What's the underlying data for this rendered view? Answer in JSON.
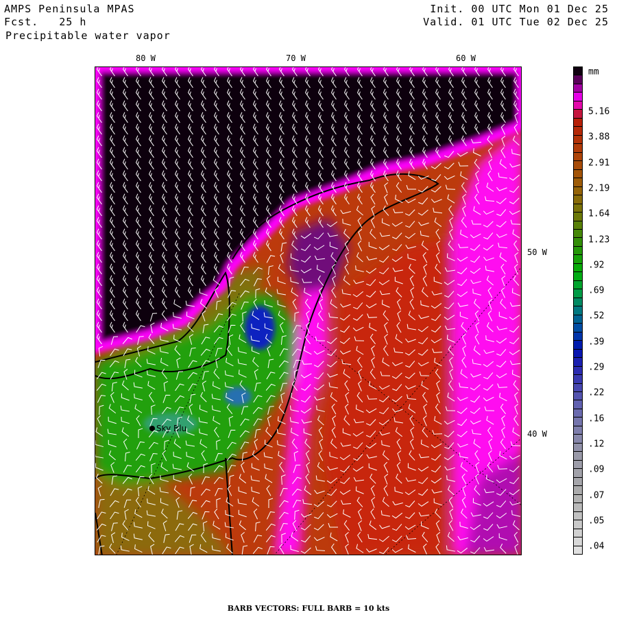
{
  "header": {
    "model": "AMPS Peninsula MPAS",
    "forecast": "Fcst.   25 h",
    "field": "Precipitable water vapor",
    "init": "Init. 00 UTC Mon 01 Dec 25",
    "valid": "Valid. 01 UTC Tue 02 Dec 25"
  },
  "map": {
    "lon_labels": [
      "80 W",
      "70 W",
      "60 W",
      "50 W",
      "40 W"
    ],
    "station": "Sky Blu"
  },
  "colorbar": {
    "units": "mm",
    "labels": [
      "5.16",
      "3.88",
      "2.91",
      "2.19",
      "1.64",
      "1.23",
      ".92",
      ".69",
      ".52",
      ".39",
      ".29",
      ".22",
      ".16",
      ".12",
      ".09",
      ".07",
      ".05",
      ".04"
    ],
    "stops": [
      [
        "0",
        "#100010"
      ],
      [
        "0.02",
        "#640064"
      ],
      [
        "0.04",
        "#b400b4"
      ],
      [
        "0.06",
        "#ff00ff"
      ],
      [
        "0.08",
        "#d0106c"
      ],
      [
        "0.10",
        "#b81c08"
      ],
      [
        "0.17",
        "#b04008"
      ],
      [
        "0.24",
        "#9c6008"
      ],
      [
        "0.30",
        "#707808"
      ],
      [
        "0.36",
        "#309008"
      ],
      [
        "0.42",
        "#00b008"
      ],
      [
        "0.46",
        "#00a040"
      ],
      [
        "0.50",
        "#007880"
      ],
      [
        "0.54",
        "#0048a8"
      ],
      [
        "0.58",
        "#0010b0"
      ],
      [
        "0.62",
        "#2828b0"
      ],
      [
        "0.70",
        "#6464b0"
      ],
      [
        "0.80",
        "#9898a8"
      ],
      [
        "0.88",
        "#acacac"
      ],
      [
        "1.0",
        "#e0e0e0"
      ]
    ]
  },
  "footer": "BARB VECTORS:  FULL BARB = 10 kts"
}
